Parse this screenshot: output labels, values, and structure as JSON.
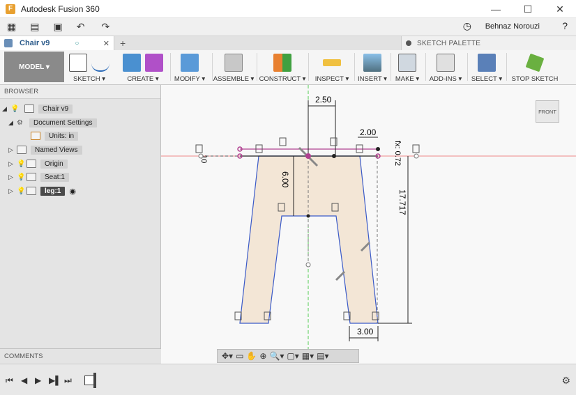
{
  "window": {
    "title": "Autodesk Fusion 360",
    "minimize": "—",
    "maximize": "☐",
    "close": "✕"
  },
  "qat": {
    "user": "Behnaz Norouzi",
    "help": "?",
    "grid_icon": "▦",
    "file_icon": "▤",
    "save_icon": "▣",
    "undo_icon": "↶",
    "redo_icon": "↷",
    "clock_icon": "◷"
  },
  "tabs": {
    "doc_name": "Chair v9",
    "close": "✕",
    "dot": "○",
    "add": "+",
    "sketch_palette": "SKETCH PALETTE"
  },
  "ribbon": {
    "model": "MODEL ▾",
    "groups": [
      {
        "label": "SKETCH ▾"
      },
      {
        "label": "CREATE ▾"
      },
      {
        "label": "MODIFY ▾"
      },
      {
        "label": "ASSEMBLE ▾"
      },
      {
        "label": "CONSTRUCT ▾"
      },
      {
        "label": "INSPECT ▾"
      },
      {
        "label": "INSERT ▾"
      },
      {
        "label": "MAKE ▾"
      },
      {
        "label": "ADD-INS ▾"
      },
      {
        "label": "SELECT ▾"
      },
      {
        "label": "STOP SKETCH"
      }
    ]
  },
  "browser": {
    "header": "BROWSER",
    "nodes": [
      {
        "label": "Chair v9"
      },
      {
        "label": "Document Settings"
      },
      {
        "label": "Units: in"
      },
      {
        "label": "Named Views"
      },
      {
        "label": "Origin"
      },
      {
        "label": "Seat:1"
      },
      {
        "label": "leg:1"
      }
    ]
  },
  "comments": "COMMENTS",
  "viewcube": "FRONT",
  "dimensions": {
    "top_width": "2.50",
    "right_offset": "2.00",
    "fx": "fx: 0.72",
    "depth": "6.00",
    "height": "17.717",
    "bottom_width": "3.00",
    "left_small": "10"
  },
  "nav_toolbar": [
    "✥▾",
    "▭",
    "✋",
    "⊕",
    "🔍▾",
    "▢▾",
    "▦▾",
    "▤▾"
  ],
  "timeline": {
    "first": "⏮",
    "prev": "◀",
    "play": "▶",
    "next": "▶▌",
    "last": "⏭",
    "gear": "⚙"
  }
}
